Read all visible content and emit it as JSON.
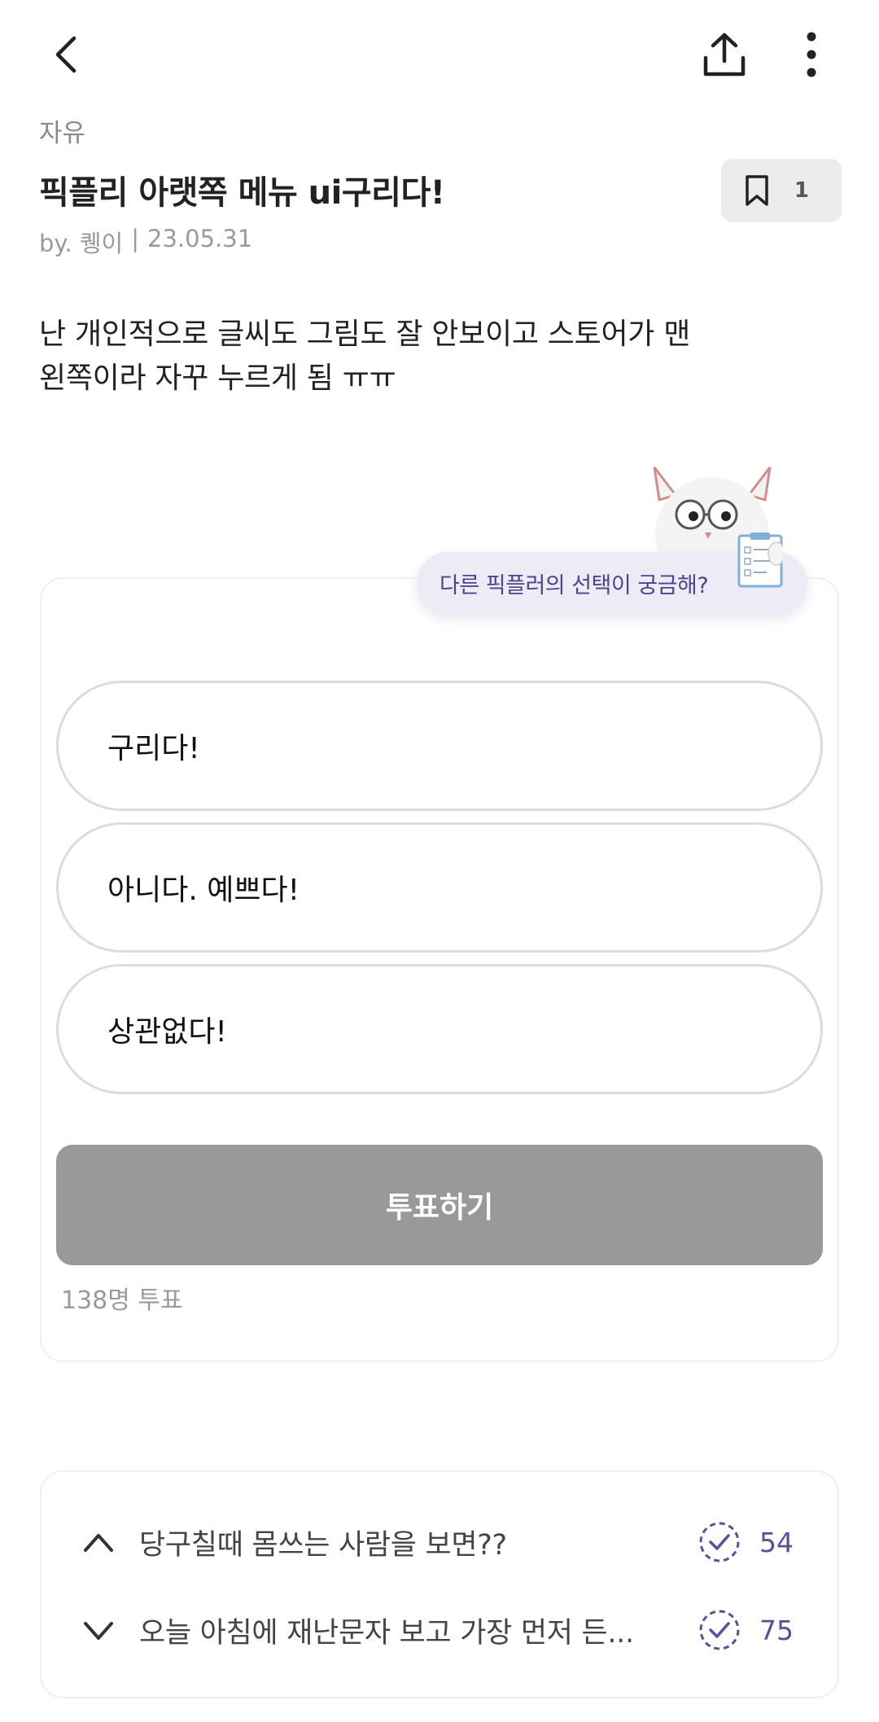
{
  "header": {
    "back_icon": "chevron-left-icon",
    "share_icon": "share-upload-icon",
    "more_icon": "more-vertical-icon"
  },
  "post": {
    "category": "자유",
    "title": "픽플리 아랫쪽 메뉴 ui구리다!",
    "author": "by. 퀭이",
    "separator": "|",
    "date": "23.05.31",
    "bookmark_count": "1",
    "body_line1": "난 개인적으로 글씨도 그림도 잘 안보이고 스토어가 맨",
    "body_line2": "왼쪽이라 자꾸 누르게 됨 ㅠㅠ"
  },
  "poll": {
    "hint_bubble": "다른 픽플러의 선택이 궁금해?",
    "options": [
      {
        "label": "구리다!"
      },
      {
        "label": "아니다. 예쁘다!"
      },
      {
        "label": "상관없다!"
      }
    ],
    "vote_button": "투표하기",
    "vote_count": "138명 투표"
  },
  "related": [
    {
      "title": "당구칠때 몸쓰는 사람을 보면??",
      "count": "54",
      "chevron": "chevron-up-icon"
    },
    {
      "title": "오늘 아침에 재난문자 보고 가장 먼저 든...",
      "count": "75",
      "chevron": "chevron-down-icon"
    }
  ],
  "colors": {
    "accent": "#5a4f9a",
    "bubble_bg": "#ecebf6",
    "vote_button_bg": "#999999",
    "option_border": "#dcdcdc"
  }
}
